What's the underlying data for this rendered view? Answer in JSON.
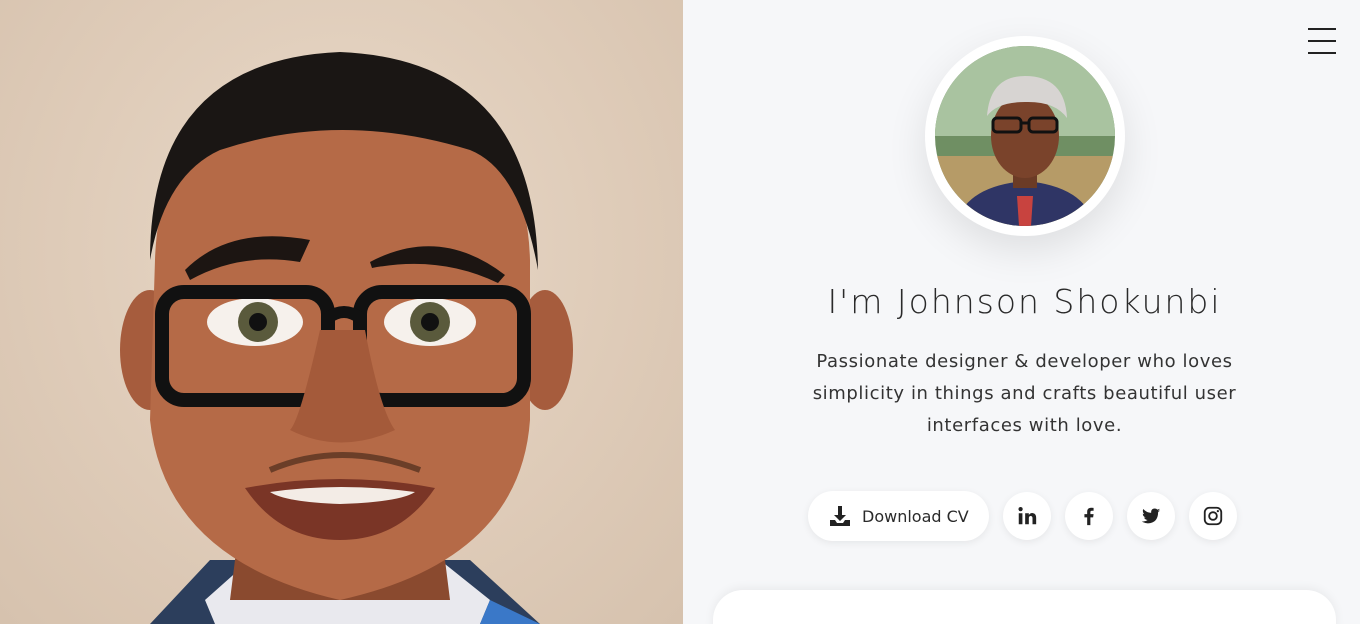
{
  "header": {
    "menu_icon": "hamburger-menu-icon"
  },
  "hero": {
    "image": "cartoon-portrait"
  },
  "profile": {
    "avatar": "profile-photo",
    "title": "I'm Johnson Shokunbi",
    "bio": "Passionate designer & developer who loves simplicity in things and crafts beautiful user interfaces with love."
  },
  "actions": {
    "download_cv_label": "Download CV",
    "download_icon": "download-icon",
    "social": [
      {
        "name": "linkedin",
        "icon": "linkedin-icon"
      },
      {
        "name": "facebook",
        "icon": "facebook-icon"
      },
      {
        "name": "twitter",
        "icon": "twitter-icon"
      },
      {
        "name": "instagram",
        "icon": "instagram-icon"
      }
    ]
  }
}
